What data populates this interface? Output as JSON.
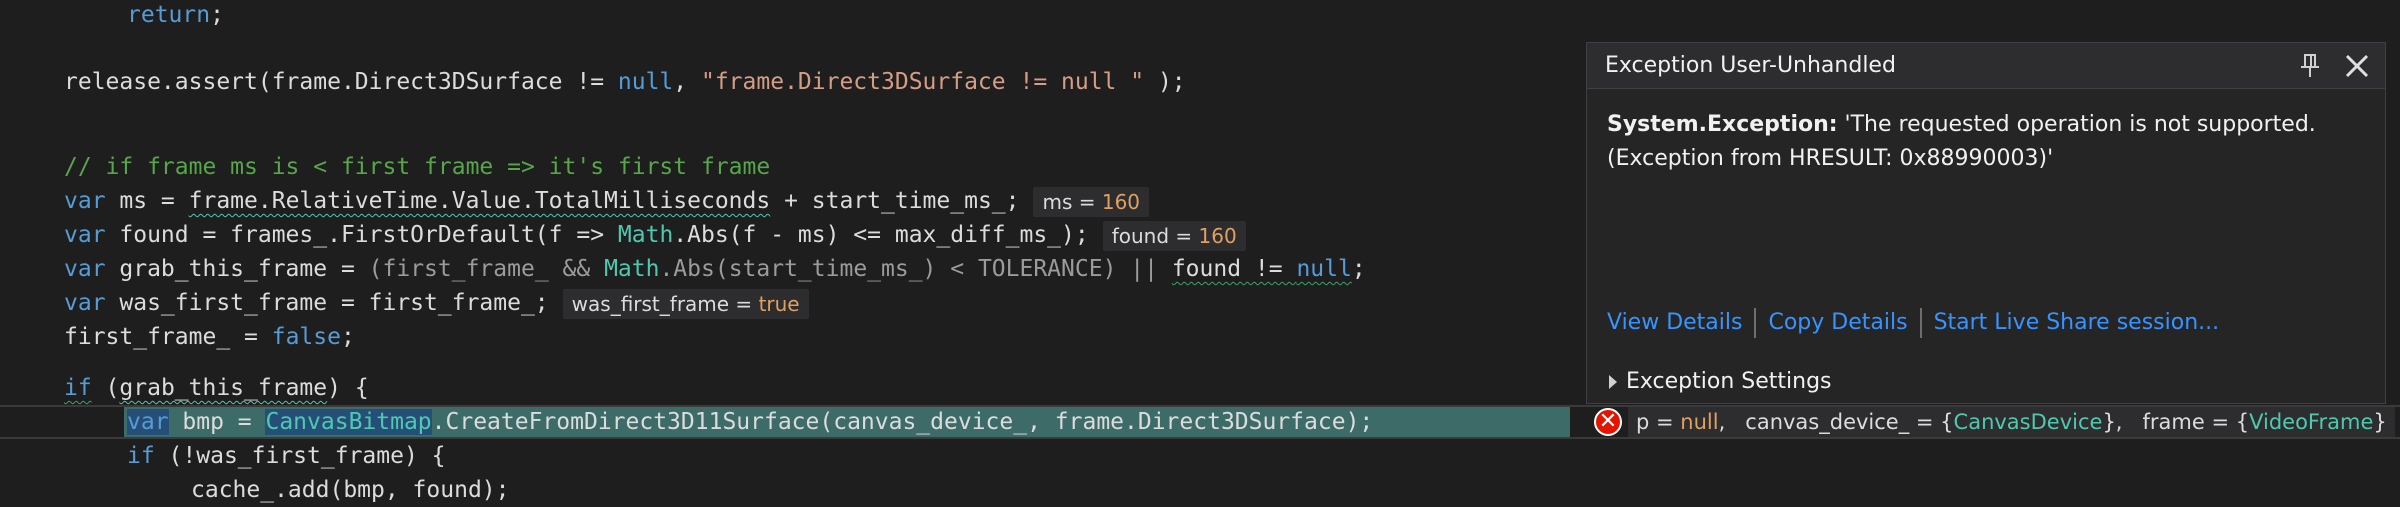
{
  "code": {
    "l1": {
      "kw": "return",
      "rest": ";"
    },
    "l2": {
      "obj": "release.assert(frame.Direct3DSurface != ",
      "kw": "null",
      "mid": ", ",
      "str": "\"frame.Direct3DSurface != null \"",
      "end": " );"
    },
    "l3": {
      "comment": "// if frame ms is < first frame => it's first frame"
    },
    "l4": {
      "kw": "var",
      "a": " ms = ",
      "b": "frame.RelativeTime.Value.TotalMilliseconds",
      "c": " + start_time_ms_;",
      "tip_name": "ms = ",
      "tip_value": "160"
    },
    "l5": {
      "kw": "var",
      "a": " found = frames_.FirstOrDefault(f => ",
      "fn": "Math",
      "b": ".Abs(f - ms) <= max_diff_ms_);",
      "tip_name": "found = ",
      "tip_value": "160"
    },
    "l6": {
      "kw": "var",
      "a": " grab_this_frame = ",
      "b": "(first_frame_ && ",
      "fn": "Math",
      "c": ".Abs(start_time_ms_) < TOLERANCE) || ",
      "d": "found != ",
      "kw2": "null",
      "e": ";"
    },
    "l7": {
      "kw": "var",
      "a": " was_first_frame = first_frame_;",
      "tip_name": "was_first_frame = ",
      "tip_value": "true"
    },
    "l8": {
      "a": "first_frame_ = ",
      "kw": "false",
      "b": ";"
    },
    "l9": {
      "kw": "if",
      "a": " (",
      "b": "grab_this_frame",
      "c": ") {"
    },
    "l10": {
      "kw": "var",
      "a": " bmp = ",
      "fn": "CanvasBitmap",
      "b": ".CreateFromDirect3D11Surface(canvas_device_, frame.Direct3DSurface);"
    },
    "l11": {
      "kw": "if",
      "a": " (!was_first_frame) {"
    },
    "l12": {
      "a": "cache_.add(bmp, found);"
    }
  },
  "error_row": {
    "icon": "error-icon",
    "p1": "p = ",
    "v1": "null",
    "p2": ",   canvas_device_ = {",
    "t2": "CanvasDevice",
    "p3": "},   frame = {",
    "t3": "VideoFrame",
    "p4": "}"
  },
  "exception": {
    "title": "Exception User-Unhandled",
    "type": "System.Exception:",
    "message": " 'The requested operation is not supported.",
    "message2": "(Exception from HRESULT: 0x88990003)'",
    "links": [
      "View Details",
      "Copy Details",
      "Start Live Share session..."
    ],
    "settings_label": "Exception Settings"
  },
  "colors": {
    "keyword": "#569cd6",
    "string": "#d69d85",
    "comment": "#57a64a",
    "type": "#4ec9b0",
    "link": "#3794ff",
    "error": "#e51400"
  }
}
